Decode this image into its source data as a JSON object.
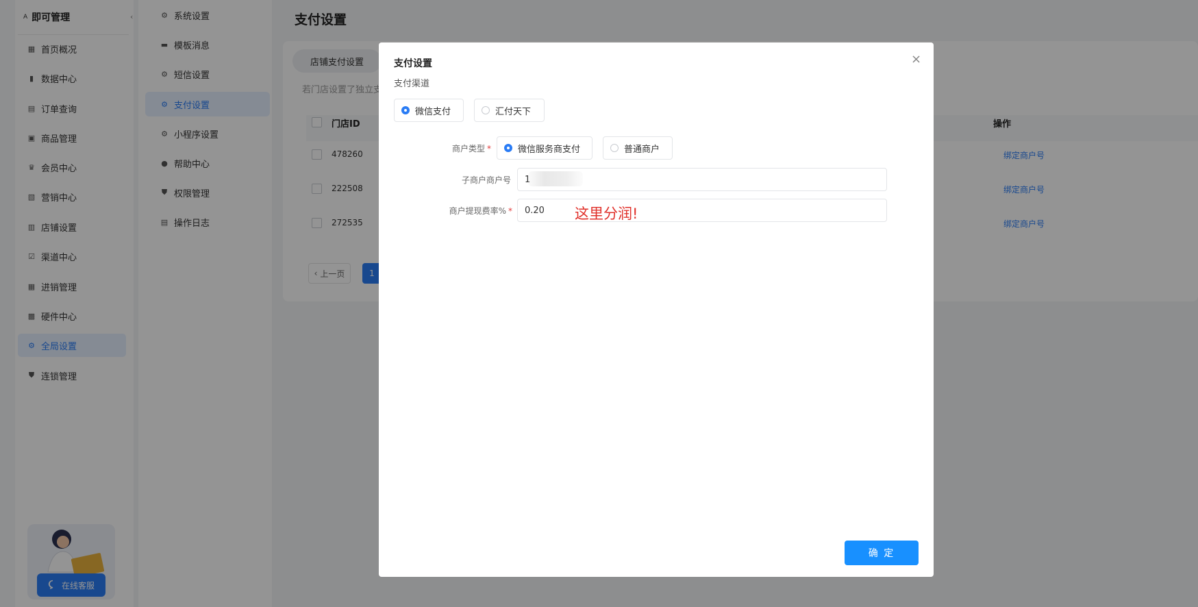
{
  "sidebar": {
    "brand": "即可管理",
    "logo_text": "A",
    "collapse_icon": "‹",
    "items": [
      {
        "label": "首页概况",
        "icon": "dashboard-icon",
        "glyph": "▦"
      },
      {
        "label": "数据中心",
        "icon": "bar-chart-icon",
        "glyph": "▮"
      },
      {
        "label": "订单查询",
        "icon": "order-icon",
        "glyph": "▤"
      },
      {
        "label": "商品管理",
        "icon": "bag-icon",
        "glyph": "▣"
      },
      {
        "label": "会员中心",
        "icon": "member-icon",
        "glyph": "♛"
      },
      {
        "label": "营销中心",
        "icon": "marketing-icon",
        "glyph": "▧"
      },
      {
        "label": "店铺设置",
        "icon": "store-icon",
        "glyph": "▥"
      },
      {
        "label": "渠道中心",
        "icon": "channel-icon",
        "glyph": "☑"
      },
      {
        "label": "进销管理",
        "icon": "inventory-icon",
        "glyph": "▦"
      },
      {
        "label": "硬件中心",
        "icon": "hardware-icon",
        "glyph": "▩"
      },
      {
        "label": "全局设置",
        "icon": "gear-icon",
        "glyph": "⚙",
        "active": true
      },
      {
        "label": "连锁管理",
        "icon": "shield-icon",
        "glyph": "⛊"
      }
    ],
    "support_label": "在线客服"
  },
  "subnav": {
    "items": [
      {
        "label": "系统设置",
        "icon": "gear-icon",
        "glyph": "⚙"
      },
      {
        "label": "模板消息",
        "icon": "message-icon",
        "glyph": "▬"
      },
      {
        "label": "短信设置",
        "icon": "gear-icon",
        "glyph": "⚙"
      },
      {
        "label": "支付设置",
        "icon": "gear-icon",
        "glyph": "⚙",
        "active": true
      },
      {
        "label": "小程序设置",
        "icon": "gear-icon",
        "glyph": "⚙"
      },
      {
        "label": "帮助中心",
        "icon": "help-icon",
        "glyph": "●"
      },
      {
        "label": "权限管理",
        "icon": "shield-icon",
        "glyph": "⛊"
      },
      {
        "label": "操作日志",
        "icon": "log-icon",
        "glyph": "▤"
      }
    ]
  },
  "main": {
    "title": "支付设置",
    "tab": "店铺支付设置",
    "hint": "若门店设置了独立支",
    "table": {
      "columns": [
        "门店ID",
        "操作"
      ],
      "rows": [
        {
          "id": "478260",
          "action": "绑定商户号"
        },
        {
          "id": "222508",
          "action": "绑定商户号"
        },
        {
          "id": "272535",
          "action": "绑定商户号"
        }
      ]
    },
    "pager": {
      "prev": "上一页",
      "current": "1"
    }
  },
  "modal": {
    "title": "支付设置",
    "section": "支付渠道",
    "channels": [
      {
        "label": "微信支付",
        "selected": true
      },
      {
        "label": "汇付天下",
        "selected": false
      }
    ],
    "merchant_type": {
      "label": "商户类型",
      "options": [
        {
          "label": "微信服务商支付",
          "selected": true
        },
        {
          "label": "普通商户",
          "selected": false
        }
      ]
    },
    "sub_merchant": {
      "label": "子商户商户号",
      "value": "1"
    },
    "fee_rate": {
      "label": "商户提现费率%",
      "value": "0.20"
    },
    "annotation": "这里分润!",
    "confirm": "确 定",
    "close_glyph": "×"
  },
  "colors": {
    "accent": "#2a7cf5",
    "confirm": "#1890ff",
    "annotation": "#e0302a",
    "required": "#e23b3b"
  }
}
